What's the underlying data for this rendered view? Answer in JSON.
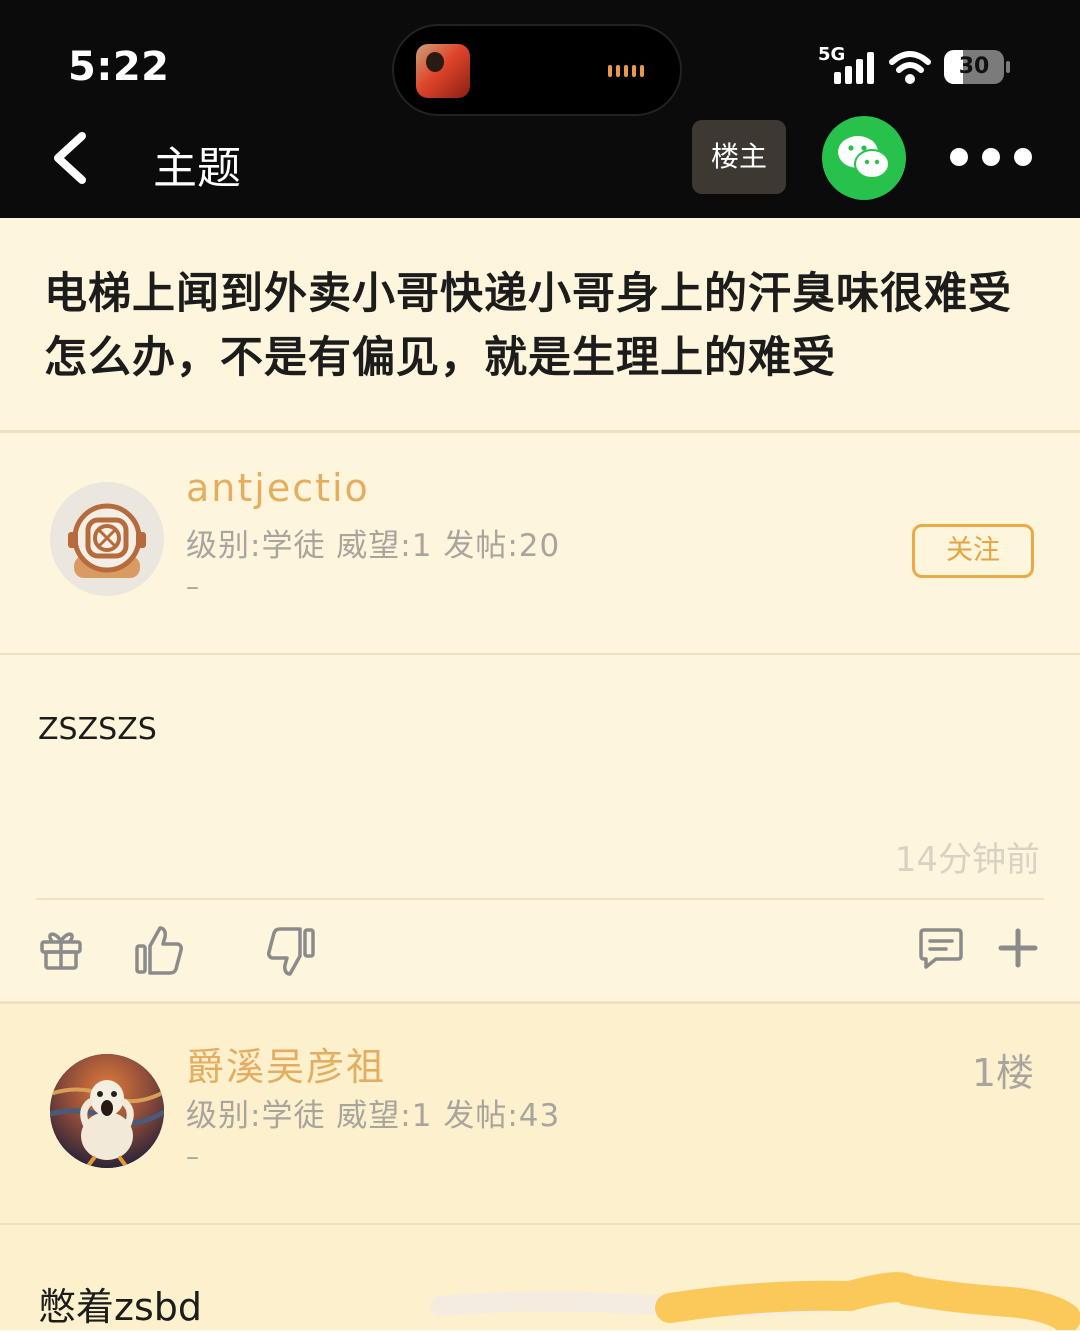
{
  "status_bar": {
    "time": "5:22",
    "network": "5G",
    "battery": "30"
  },
  "nav": {
    "title": "主题",
    "host_button": "楼主"
  },
  "thread": {
    "title": "电梯上闻到外卖小哥快递小哥身上的汗臭味很难受怎么办，不是有偏见，就是生理上的难受"
  },
  "original_post": {
    "username": "antjectio",
    "meta": "级别:学徒 威望:1 发帖:20",
    "signature": "–",
    "follow_label": "关注",
    "content": "ZSZSZS",
    "time_ago": "14分钟前"
  },
  "reply": {
    "username": "爵溪吴彦祖",
    "meta": "级别:学徒 威望:1 发帖:43",
    "signature": "–",
    "floor": "1楼",
    "content": "憋着zsbd"
  },
  "colors": {
    "background": "#fdf5dc",
    "accent": "#e6ad60",
    "wechat_green": "#27c24c",
    "topbar": "#0b0b0b"
  }
}
